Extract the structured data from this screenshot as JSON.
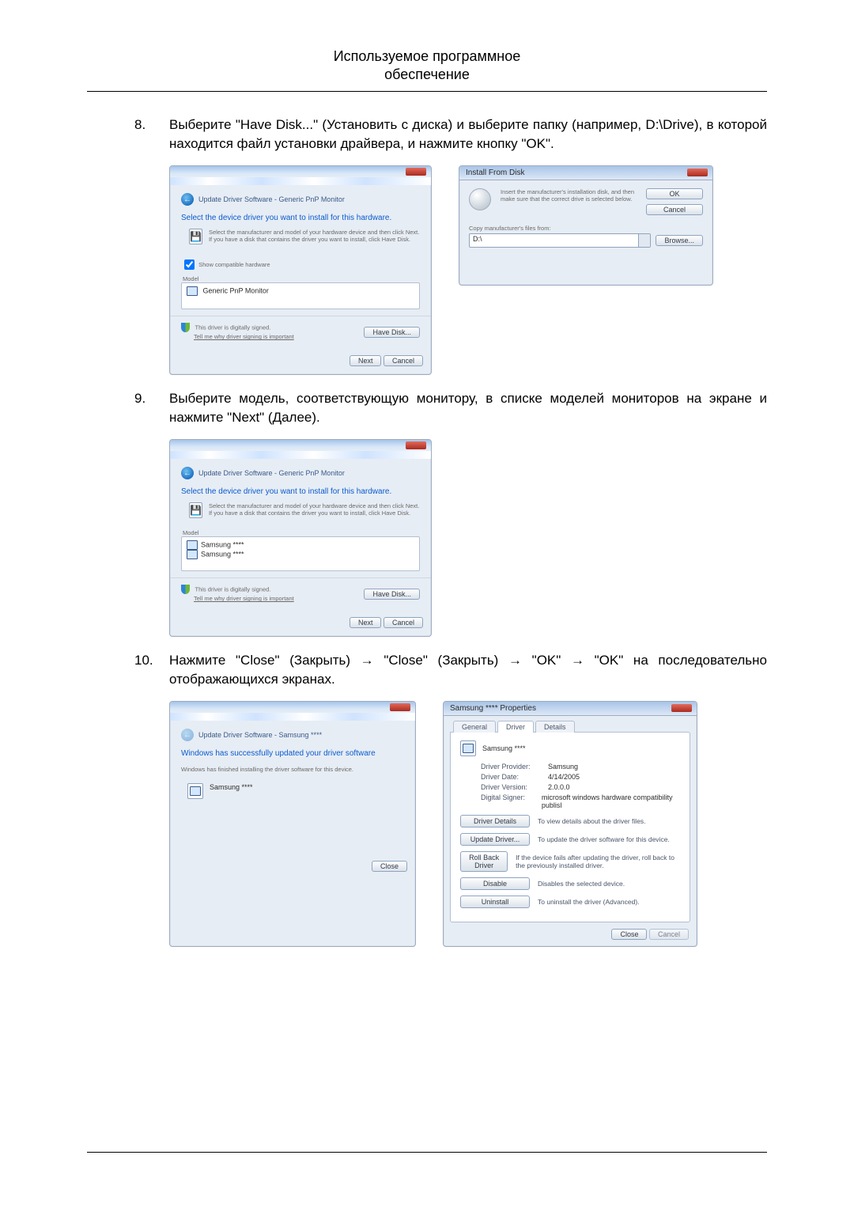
{
  "header": {
    "line1": "Используемое программное",
    "line2": "обеспечение"
  },
  "steps": {
    "s8": {
      "num": "8.",
      "text": "Выберите \"Have Disk...\" (Установить с диска) и выберите папку (например, D:\\Drive), в которой находится файл установки драйвера, и нажмите кнопку \"OK\"."
    },
    "s9": {
      "num": "9.",
      "text": "Выберите модель, соответствующую монитору, в списке моделей мониторов на экране и нажмите \"Next\" (Далее)."
    },
    "s10": {
      "num": "10.",
      "text": "Нажмите \"Close\" (Закрыть) → \"Close\" (Закрыть) → \"OK\" → \"OK\" на последовательно отображающихся экранах."
    }
  },
  "wiz_generic": {
    "bread": "Update Driver Software - Generic PnP Monitor",
    "head": "Select the device driver you want to install for this hardware.",
    "subtext": "Select the manufacturer and model of your hardware device and then click Next. If you have a disk that contains the driver you want to install, click Have Disk.",
    "compat": "Show compatible hardware",
    "model_label": "Model",
    "model_item": "Generic PnP Monitor",
    "signed": "This driver is digitally signed.",
    "why": "Tell me why driver signing is important",
    "have_disk": "Have Disk...",
    "next": "Next",
    "cancel": "Cancel"
  },
  "ifd": {
    "title": "Install From Disk",
    "msg": "Insert the manufacturer's installation disk, and then make sure that the correct drive is selected below.",
    "ok": "OK",
    "cancel": "Cancel",
    "copy_label": "Copy manufacturer's files from:",
    "path": "D:\\",
    "browse": "Browse..."
  },
  "wiz_models": {
    "bread": "Update Driver Software - Generic PnP Monitor",
    "head": "Select the device driver you want to install for this hardware.",
    "subtext": "Select the manufacturer and model of your hardware device and then click Next. If you have a disk that contains the driver you want to install, click Have Disk.",
    "model_label": "Model",
    "m1": "Samsung ****",
    "m2": "Samsung ****",
    "signed": "This driver is digitally signed.",
    "why": "Tell me why driver signing is important",
    "have_disk": "Have Disk...",
    "next": "Next",
    "cancel": "Cancel"
  },
  "wiz_done": {
    "bread": "Update Driver Software - Samsung ****",
    "head": "Windows has successfully updated your driver software",
    "subtext": "Windows has finished installing the driver software for this device.",
    "device": "Samsung ****",
    "close": "Close"
  },
  "props": {
    "title": "Samsung **** Properties",
    "tab_general": "General",
    "tab_driver": "Driver",
    "tab_details": "Details",
    "device": "Samsung ****",
    "k_provider": "Driver Provider:",
    "v_provider": "Samsung",
    "k_date": "Driver Date:",
    "v_date": "4/14/2005",
    "k_version": "Driver Version:",
    "v_version": "2.0.0.0",
    "k_signer": "Digital Signer:",
    "v_signer": "microsoft windows hardware compatibility publisl",
    "b_details": "Driver Details",
    "d_details": "To view details about the driver files.",
    "b_update": "Update Driver...",
    "d_update": "To update the driver software for this device.",
    "b_rollback": "Roll Back Driver",
    "d_rollback": "If the device fails after updating the driver, roll back to the previously installed driver.",
    "b_disable": "Disable",
    "d_disable": "Disables the selected device.",
    "b_uninstall": "Uninstall",
    "d_uninstall": "To uninstall the driver (Advanced).",
    "close": "Close",
    "cancel": "Cancel"
  }
}
